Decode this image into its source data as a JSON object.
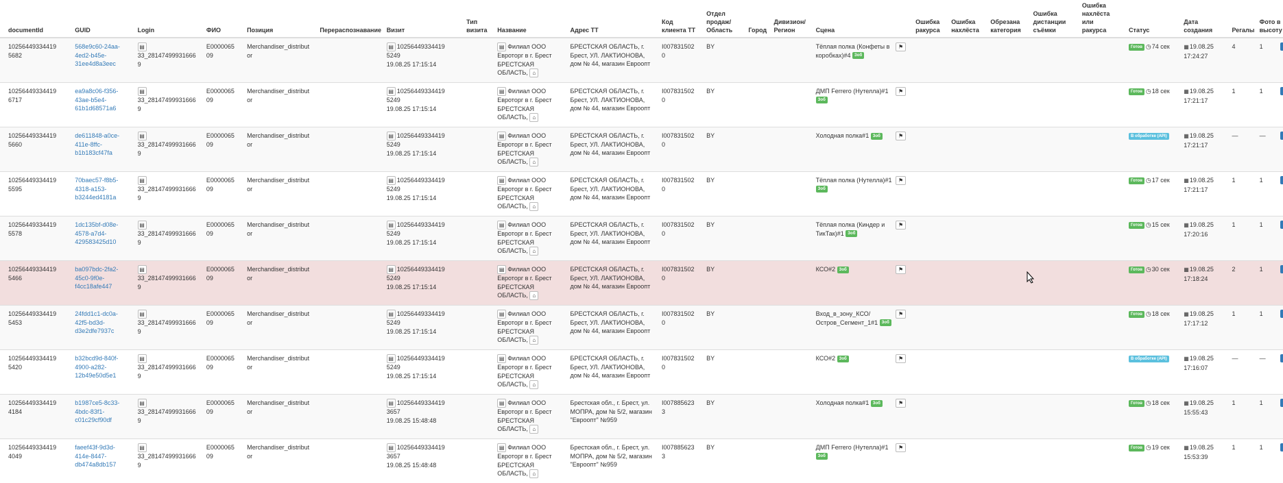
{
  "columns": [
    "documentId",
    "GUID",
    "Login",
    "ФИО",
    "Позиция",
    "Перераспознавание",
    "Визит",
    "Тип визита",
    "Название",
    "Адрес ТТ",
    "Код клиента ТТ",
    "Отдел продаж/ Область",
    "Город",
    "Дивизион/ Регион",
    "Сцена",
    "Ошибка ракурса",
    "Ошибка нахлёста",
    "Обрезана категория",
    "Ошибка дистанции съёмки",
    "Ошибка нахлёста или ракурса",
    "Статус",
    "Дата создания",
    "Регалы",
    "Фото в высоту"
  ],
  "rows": [
    {
      "documentId": "10256449334419​5682",
      "guid": "568e9c60-24aa-4ed2-b45e-31ee4d8a3eec",
      "login": "33_281474999316669",
      "fio": "E000006509",
      "position": "Merchandiser_distributor",
      "visit_id": "10256449334419​5249",
      "visit_date": "19.08.25 17:15:14",
      "name": "Филиал ООО Евроторг в г. Брест БРЕСТСКАЯ ОБЛАСТЬ,",
      "address": "БРЕСТСКАЯ ОБЛАСТЬ, г. Брест, УЛ. ЛАКТИОНОВА, дом № 44, магазин Евроопт",
      "client_code": "I0078315020",
      "region": "BY",
      "scene": "Тёплая полка (Конфеты в коробках)#4",
      "status_kind": "ok",
      "status": "Готов",
      "duration": "74 сек",
      "date": "19.08.25",
      "time": "17:24:27",
      "shelves": "4",
      "photos": "1"
    },
    {
      "documentId": "10256449334419​6717",
      "guid": "ea9a8c06-f356-43ae-b5e4-61b1d68571a6",
      "login": "33_281474999316669",
      "fio": "E000006509",
      "position": "Merchandiser_distributor",
      "visit_id": "10256449334419​5249",
      "visit_date": "19.08.25 17:15:14",
      "name": "Филиал ООО Евроторг в г. Брест БРЕСТСКАЯ ОБЛАСТЬ,",
      "address": "БРЕСТСКАЯ ОБЛАСТЬ, г. Брест, УЛ. ЛАКТИОНОВА, дом № 44, магазин Евроопт",
      "client_code": "I0078315020",
      "region": "BY",
      "scene": "ДМП Ferrero (Нутелла)#1",
      "status_kind": "ok",
      "status": "Готов",
      "duration": "18 сек",
      "date": "19.08.25",
      "time": "17:21:17",
      "shelves": "1",
      "photos": "1"
    },
    {
      "documentId": "10256449334419​5660",
      "guid": "de611848-a0ce-411e-8ffc-b1b183cf47fa",
      "login": "33_281474999316669",
      "fio": "E000006509",
      "position": "Merchandiser_distributor",
      "visit_id": "10256449334419​5249",
      "visit_date": "19.08.25 17:15:14",
      "name": "Филиал ООО Евроторг в г. Брест БРЕСТСКАЯ ОБЛАСТЬ,",
      "address": "БРЕСТСКАЯ ОБЛАСТЬ, г. Брест, УЛ. ЛАКТИОНОВА, дом № 44, магазин Евроопт",
      "client_code": "I0078315020",
      "region": "BY",
      "scene": "Холодная полка#1",
      "status_kind": "info",
      "status": "В обработке (API)",
      "duration": "",
      "date": "19.08.25",
      "time": "17:21:17",
      "shelves": "—",
      "photos": "—"
    },
    {
      "documentId": "10256449334419​5595",
      "guid": "70baec57-f8b5-4318-a153-b3244ed4181a",
      "login": "33_281474999316669",
      "fio": "E000006509",
      "position": "Merchandiser_distributor",
      "visit_id": "10256449334419​5249",
      "visit_date": "19.08.25 17:15:14",
      "name": "Филиал ООО Евроторг в г. Брест БРЕСТСКАЯ ОБЛАСТЬ,",
      "address": "БРЕСТСКАЯ ОБЛАСТЬ, г. Брест, УЛ. ЛАКТИОНОВА, дом № 44, магазин Евроопт",
      "client_code": "I0078315020",
      "region": "BY",
      "scene": "Тёплая полка (Нутелла)#1",
      "status_kind": "ok",
      "status": "Готов",
      "duration": "17 сек",
      "date": "19.08.25",
      "time": "17:21:17",
      "shelves": "1",
      "photos": "1"
    },
    {
      "documentId": "10256449334419​5578",
      "guid": "1dc135bf-d08e-4578-a7d4-429583425d10",
      "login": "33_281474999316669",
      "fio": "E000006509",
      "position": "Merchandiser_distributor",
      "visit_id": "10256449334419​5249",
      "visit_date": "19.08.25 17:15:14",
      "name": "Филиал ООО Евроторг в г. Брест БРЕСТСКАЯ ОБЛАСТЬ,",
      "address": "БРЕСТСКАЯ ОБЛАСТЬ, г. Брест, УЛ. ЛАКТИОНОВА, дом № 44, магазин Евроопт",
      "client_code": "I0078315020",
      "region": "BY",
      "scene": "Тёплая полка (Киндер и ТикТак)#1",
      "status_kind": "ok",
      "status": "Готов",
      "duration": "15 сек",
      "date": "19.08.25",
      "time": "17:20:16",
      "shelves": "1",
      "photos": "1"
    },
    {
      "documentId": "10256449334419​5466",
      "guid": "ba097bdc-2fa2-45c0-9f0e-f4cc18afe447",
      "login": "33_281474999316669",
      "fio": "E000006509",
      "position": "Merchandiser_distributor",
      "visit_id": "10256449334419​5249",
      "visit_date": "19.08.25 17:15:14",
      "name": "Филиал ООО Евроторг в г. Брест БРЕСТСКАЯ ОБЛАСТЬ,",
      "address": "БРЕСТСКАЯ ОБЛАСТЬ, г. Брест, УЛ. ЛАКТИОНОВА, дом № 44, магазин Евроопт",
      "client_code": "I0078315020",
      "region": "BY",
      "scene": "КСО#2",
      "status_kind": "ok",
      "status": "Готов",
      "duration": "30 сек",
      "date": "19.08.25",
      "time": "17:18:24",
      "shelves": "2",
      "photos": "1"
    },
    {
      "documentId": "10256449334419​5453",
      "guid": "24fdd1c1-dc0a-42f5-bd3d-d3e2dfe7937c",
      "login": "33_281474999316669",
      "fio": "E000006509",
      "position": "Merchandiser_distributor",
      "visit_id": "10256449334419​5249",
      "visit_date": "19.08.25 17:15:14",
      "name": "Филиал ООО Евроторг в г. Брест БРЕСТСКАЯ ОБЛАСТЬ,",
      "address": "БРЕСТСКАЯ ОБЛАСТЬ, г. Брест, УЛ. ЛАКТИОНОВА, дом № 44, магазин Евроопт",
      "client_code": "I0078315020",
      "region": "BY",
      "scene": "Вход_в_зону_КСО/ Остров_Сегмент_1#1",
      "status_kind": "ok",
      "status": "Готов",
      "duration": "18 сек",
      "date": "19.08.25",
      "time": "17:17:12",
      "shelves": "1",
      "photos": "1"
    },
    {
      "documentId": "10256449334419​5420",
      "guid": "b32bcd9d-840f-4900-a282-12b49e50d5e1",
      "login": "33_281474999316669",
      "fio": "E000006509",
      "position": "Merchandiser_distributor",
      "visit_id": "10256449334419​5249",
      "visit_date": "19.08.25 17:15:14",
      "name": "Филиал ООО Евроторг в г. Брест БРЕСТСКАЯ ОБЛАСТЬ,",
      "address": "БРЕСТСКАЯ ОБЛАСТЬ, г. Брест, УЛ. ЛАКТИОНОВА, дом № 44, магазин Евроопт",
      "client_code": "I0078315020",
      "region": "BY",
      "scene": "КСО#2",
      "status_kind": "info",
      "status": "В обработке (API)",
      "duration": "",
      "date": "19.08.25",
      "time": "17:16:07",
      "shelves": "—",
      "photos": "—"
    },
    {
      "documentId": "10256449334419​4184",
      "guid": "b1987ce5-8c33-4bdc-83f1-c01c29cf90df",
      "login": "33_281474999316669",
      "fio": "E000006509",
      "position": "Merchandiser_distributor",
      "visit_id": "10256449334419​3657",
      "visit_date": "19.08.25 15:48:48",
      "name": "Филиал ООО Евроторг в г. Брест БРЕСТСКАЯ ОБЛАСТЬ,",
      "address": "Брестская обл., г. Брест, ул. МОПРА, дом № 5/2, магазин \"Евроопт\" №959",
      "client_code": "I0078856233",
      "region": "BY",
      "scene": "Холодная полка#1",
      "status_kind": "ok",
      "status": "Готов",
      "duration": "18 сек",
      "date": "19.08.25",
      "time": "15:55:43",
      "shelves": "1",
      "photos": "1"
    },
    {
      "documentId": "10256449334419​4049",
      "guid": "faeef43f-9d3d-414e-8447-db474a8db157",
      "login": "33_281474999316669",
      "fio": "E000006509",
      "position": "Merchandiser_distributor",
      "visit_id": "10256449334419​3657",
      "visit_date": "19.08.25 15:48:48",
      "name": "Филиал ООО Евроторг в г. Брест БРЕСТСКАЯ ОБЛАСТЬ,",
      "address": "Брестская обл., г. Брест, ул. МОПРА, дом № 5/2, магазин \"Евроопт\" №959",
      "client_code": "I0078856233",
      "region": "BY",
      "scene": "ДМП Ferrero (Нутелла)#1",
      "status_kind": "ok",
      "status": "Готов",
      "duration": "19 сек",
      "date": "19.08.25",
      "time": "15:53:39",
      "shelves": "1",
      "photos": "1"
    }
  ],
  "scene_badge": "Зоб",
  "icons": {
    "doc": "document-icon",
    "home": "home-icon",
    "flag": "flag-icon",
    "clock": "clock-icon",
    "calendar": "calendar-icon"
  },
  "colors": {
    "link": "#337ab7",
    "ok": "#5cb85c",
    "info": "#5bc0de",
    "highlight": "#f2dede"
  }
}
